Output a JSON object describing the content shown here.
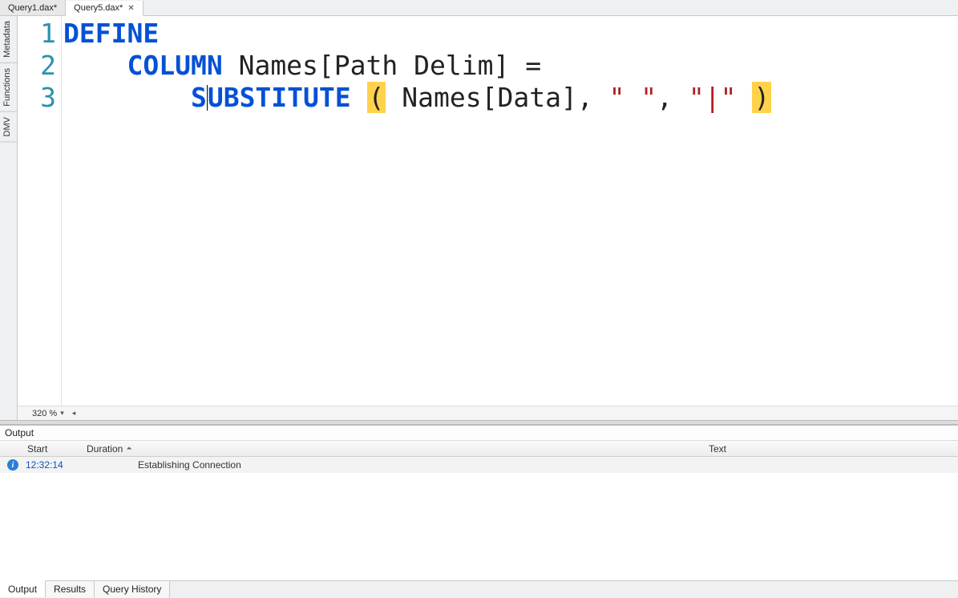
{
  "tabs": [
    {
      "label": "Query1.dax*",
      "active": false
    },
    {
      "label": "Query5.dax*",
      "active": true
    }
  ],
  "side_tabs": [
    "Metadata",
    "Functions",
    "DMV"
  ],
  "editor": {
    "line_numbers": [
      "1",
      "2",
      "3"
    ],
    "tokens": {
      "l1_define": "DEFINE",
      "l2_indent": "    ",
      "l2_column": "COLUMN",
      "l2_sp1": " ",
      "l2_ident": "Names[Path Delim]",
      "l2_sp2": " ",
      "l2_eq": "=",
      "l3_indent": "        ",
      "l3_func": "SUBSTITUTE",
      "l3_sp1": " ",
      "l3_lp": "(",
      "l3_sp2": " ",
      "l3_arg1": "Names[Data]",
      "l3_c1": ",",
      "l3_sp3": " ",
      "l3_str1": "\" \"",
      "l3_c2": ",",
      "l3_sp4": " ",
      "l3_str2": "\"|\"",
      "l3_sp5": " ",
      "l3_rp": ")"
    }
  },
  "zoom": "320 %",
  "output": {
    "title": "Output",
    "headers": {
      "start": "Start",
      "duration": "Duration",
      "text": "Text"
    },
    "rows": [
      {
        "start": "12:32:14",
        "duration": "",
        "text": "Establishing Connection"
      }
    ]
  },
  "bottom_tabs": [
    {
      "label": "Output",
      "active": true
    },
    {
      "label": "Results",
      "active": false
    },
    {
      "label": "Query History",
      "active": false
    }
  ]
}
